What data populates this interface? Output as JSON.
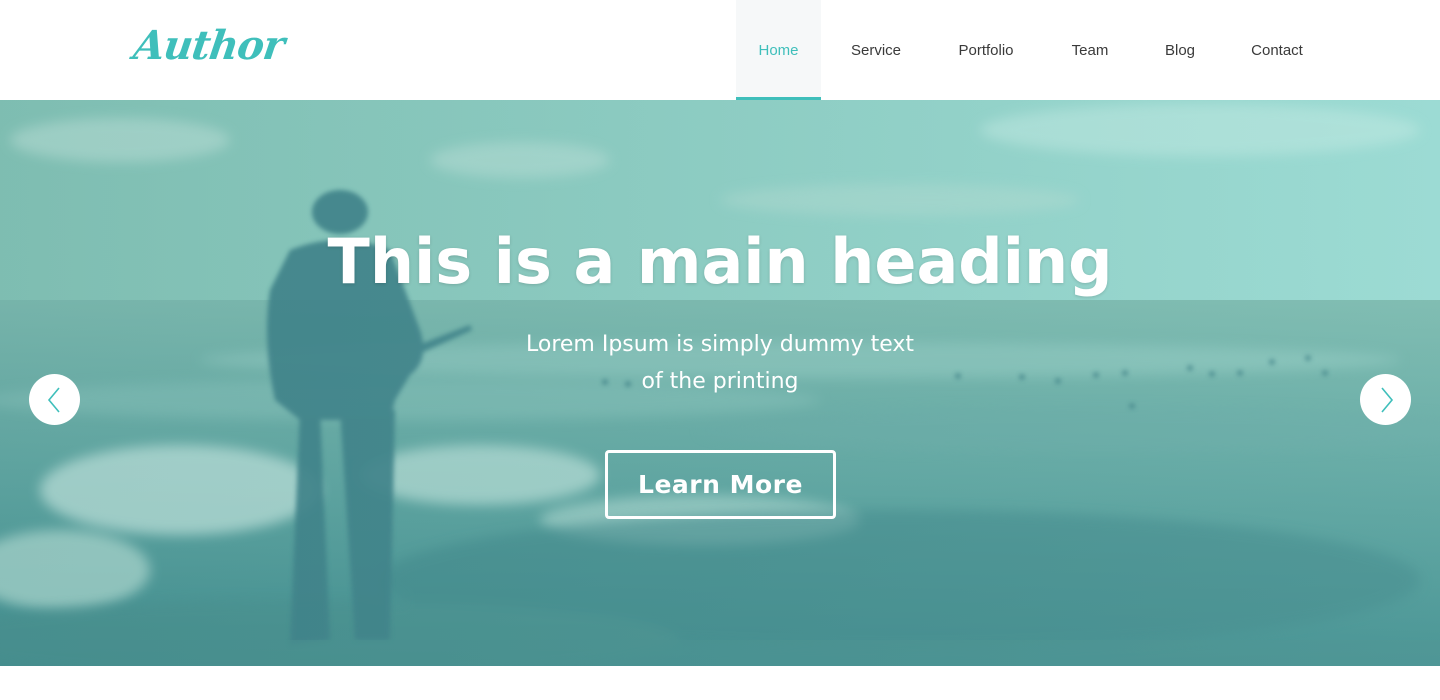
{
  "brand": {
    "logo": "Author",
    "accent_color": "#3fbfbb"
  },
  "nav": {
    "items": [
      {
        "label": "Home",
        "active": true
      },
      {
        "label": "Service",
        "active": false
      },
      {
        "label": "Portfolio",
        "active": false
      },
      {
        "label": "Team",
        "active": false
      },
      {
        "label": "Blog",
        "active": false
      },
      {
        "label": "Contact",
        "active": false
      }
    ]
  },
  "hero": {
    "heading": "This is a main heading",
    "subtext_line1": "Lorem Ipsum is simply dummy text",
    "subtext_line2": "of the printing",
    "button_label": "Learn More",
    "prev_icon": "chevron-left-icon",
    "next_icon": "chevron-right-icon"
  }
}
